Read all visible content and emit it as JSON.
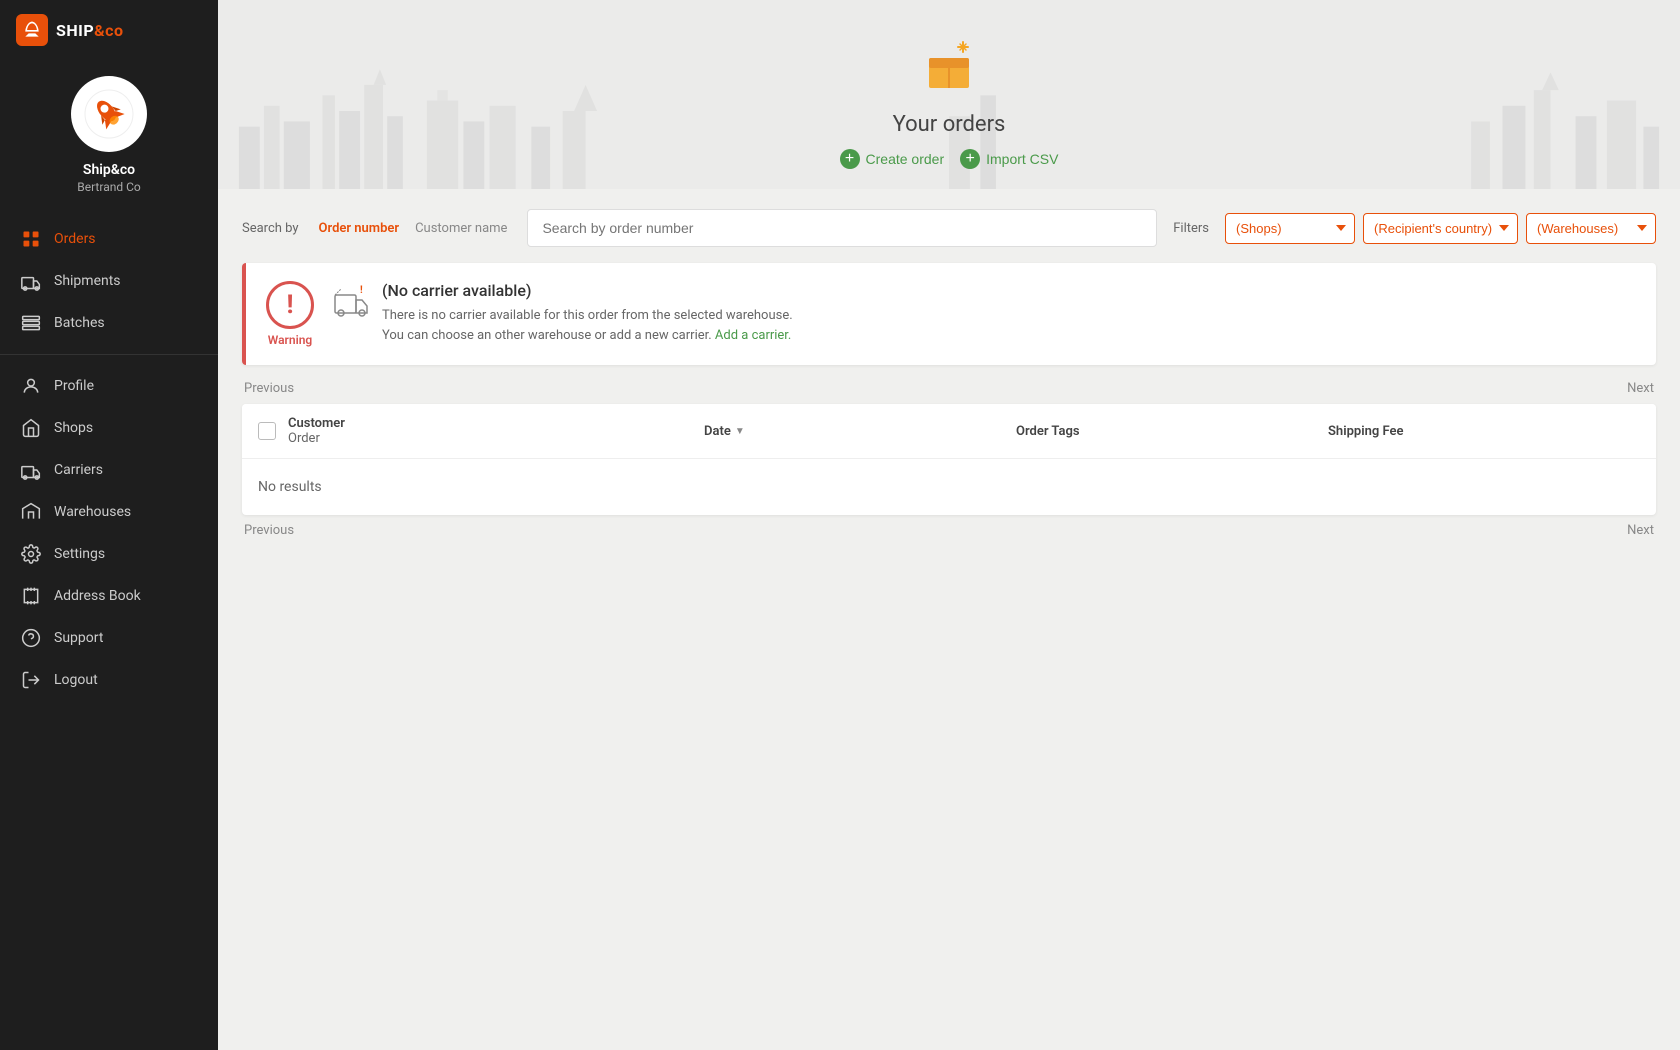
{
  "app": {
    "name": "SHIP",
    "name_accent": "&co",
    "logo_emoji": "🚀"
  },
  "profile": {
    "name": "Ship&co",
    "company": "Bertrand Co"
  },
  "sidebar": {
    "items": [
      {
        "id": "orders",
        "label": "Orders",
        "icon": "orders-icon",
        "active": true
      },
      {
        "id": "shipments",
        "label": "Shipments",
        "icon": "shipments-icon",
        "active": false
      },
      {
        "id": "batches",
        "label": "Batches",
        "icon": "batches-icon",
        "active": false
      },
      {
        "id": "profile",
        "label": "Profile",
        "icon": "profile-icon",
        "active": false
      },
      {
        "id": "shops",
        "label": "Shops",
        "icon": "shops-icon",
        "active": false
      },
      {
        "id": "carriers",
        "label": "Carriers",
        "icon": "carriers-icon",
        "active": false
      },
      {
        "id": "warehouses",
        "label": "Warehouses",
        "icon": "warehouses-icon",
        "active": false
      },
      {
        "id": "settings",
        "label": "Settings",
        "icon": "settings-icon",
        "active": false
      },
      {
        "id": "address-book",
        "label": "Address Book",
        "icon": "address-book-icon",
        "active": false
      },
      {
        "id": "support",
        "label": "Support",
        "icon": "support-icon",
        "active": false
      },
      {
        "id": "logout",
        "label": "Logout",
        "icon": "logout-icon",
        "active": false
      }
    ]
  },
  "hero": {
    "title": "Your orders",
    "create_order_label": "Create order",
    "import_csv_label": "Import CSV"
  },
  "search": {
    "by_label": "Search by",
    "tab_order_number": "Order number",
    "tab_customer_name": "Customer name",
    "placeholder": "Search by order number",
    "filters_label": "Filters",
    "filter_shops": "(Shops)",
    "filter_country": "(Recipient's country)",
    "filter_warehouses": "(Warehouses)"
  },
  "warning": {
    "label": "Warning",
    "title": "(No carrier available)",
    "line1": "There is no carrier available for this order from the selected warehouse.",
    "line2": "You can choose an other warehouse or add a new carrier.",
    "link_text": "Add a carrier."
  },
  "pagination": {
    "previous": "Previous",
    "next": "Next"
  },
  "table": {
    "col_customer": "Customer",
    "col_order": "Order",
    "col_date": "Date",
    "col_tags": "Order Tags",
    "col_fee": "Shipping Fee",
    "no_results": "No results"
  }
}
